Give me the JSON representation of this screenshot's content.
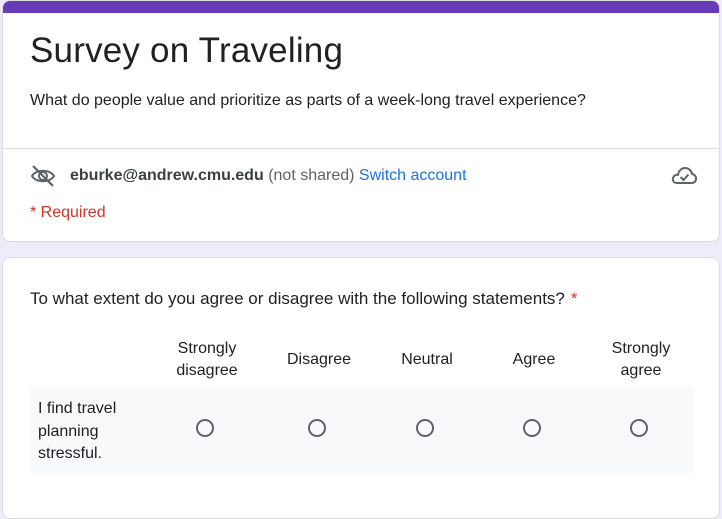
{
  "theme": {
    "accent_color": "#673ab7",
    "link_color": "#1a73e8",
    "required_color": "#d93025"
  },
  "header": {
    "title": "Survey on Traveling",
    "description": "What do people value and prioritize as parts of a week-long travel experience?"
  },
  "account": {
    "icon": "visibility-off-icon",
    "email": "eburke@andrew.cmu.edu",
    "shared_note": "(not shared)",
    "switch_label": "Switch account",
    "save_status_icon": "cloud-done-icon"
  },
  "required_note": "* Required",
  "question": {
    "text": "To what extent do you agree or disagree with the following statements?",
    "required_marker": "*",
    "columns": [
      {
        "line1": "Strongly",
        "line2": "disagree"
      },
      {
        "line1": "Disagree",
        "line2": ""
      },
      {
        "line1": "Neutral",
        "line2": ""
      },
      {
        "line1": "Agree",
        "line2": ""
      },
      {
        "line1": "Strongly",
        "line2": "agree"
      }
    ],
    "rows": [
      {
        "label_lines": [
          "I find travel",
          "planning",
          "stressful."
        ]
      }
    ]
  }
}
